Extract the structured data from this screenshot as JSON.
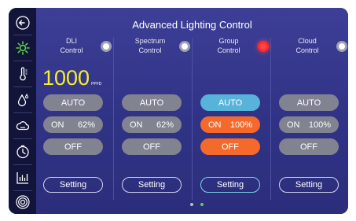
{
  "title": "Advanced Lighting  Control",
  "sidebar": {
    "items": [
      {
        "icon": "back-arrow-icon"
      },
      {
        "icon": "sun-icon",
        "active_color": "#5ed34a"
      },
      {
        "icon": "thermometer-icon"
      },
      {
        "icon": "humidity-drop-icon"
      },
      {
        "icon": "cloud-icon"
      },
      {
        "icon": "timer-icon"
      },
      {
        "icon": "chart-icon"
      },
      {
        "icon": "target-icon"
      }
    ]
  },
  "columns": [
    {
      "label": "DLI\nControl",
      "selected": false,
      "big_value": "1000",
      "big_unit": "PPFD",
      "auto_label": "AUTO",
      "on_label": "ON",
      "on_percent": "62%",
      "off_label": "OFF",
      "setting_label": "Setting",
      "active_mode": "none"
    },
    {
      "label": "Spectrum\nControl",
      "selected": false,
      "auto_label": "AUTO",
      "on_label": "ON",
      "on_percent": "62%",
      "off_label": "OFF",
      "setting_label": "Setting",
      "active_mode": "none"
    },
    {
      "label": "Group\nControl",
      "selected": true,
      "auto_label": "AUTO",
      "on_label": "ON",
      "on_percent": "100%",
      "off_label": "OFF",
      "setting_label": "Setting",
      "active_mode": "auto+on+off"
    },
    {
      "label": "Cloud\nControl",
      "selected": false,
      "auto_label": "AUTO",
      "on_label": "ON",
      "on_percent": "100%",
      "off_label": "OFF",
      "setting_label": "Setting",
      "active_mode": "none"
    }
  ],
  "pager": {
    "pages": 2,
    "current": 2
  },
  "colors": {
    "accent_blue": "#57b3d9",
    "accent_orange": "#f56a2b",
    "value_yellow": "#f5f02a",
    "radio_active": "#ff2a2a",
    "pager_active": "#5ed34a"
  }
}
